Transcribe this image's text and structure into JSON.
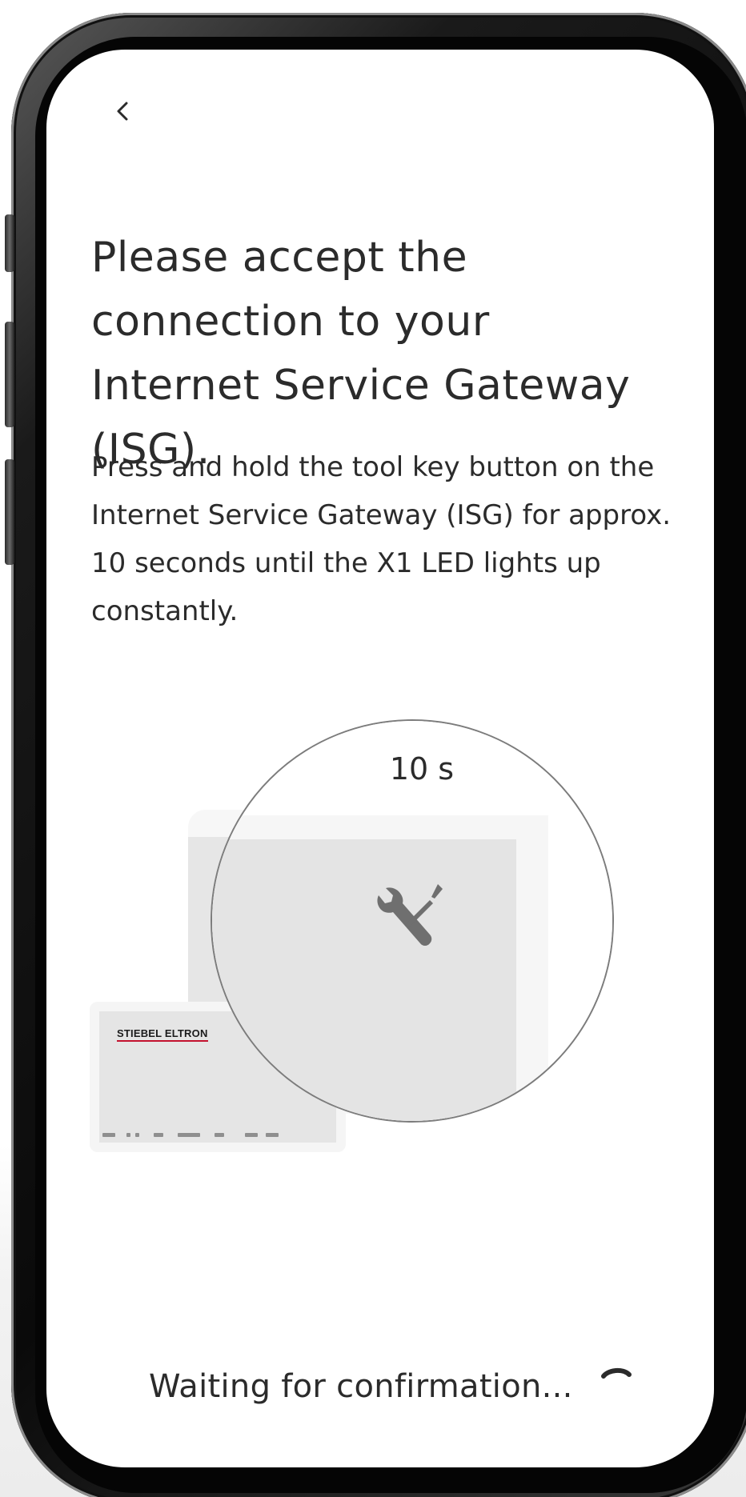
{
  "nav": {
    "back_icon": "chevron-left-icon"
  },
  "content": {
    "title": "Please accept the connection to your Internet Service Gateway (ISG).",
    "instruction": "Press and hold the tool key button on the Internet Service Gateway (ISG) for approx. 10 seconds until the X1 LED lights up constantly."
  },
  "illustration": {
    "timer": "10 s",
    "brand": "STIEBEL ELTRON",
    "key_icon": "tool-key-icon"
  },
  "status": {
    "text": "Waiting for confirmation...",
    "spinner_icon": "loading-spinner-icon"
  },
  "colors": {
    "text": "#2b2b2b",
    "brand_accent": "#c4122f",
    "panel": "#e4e4e4"
  }
}
